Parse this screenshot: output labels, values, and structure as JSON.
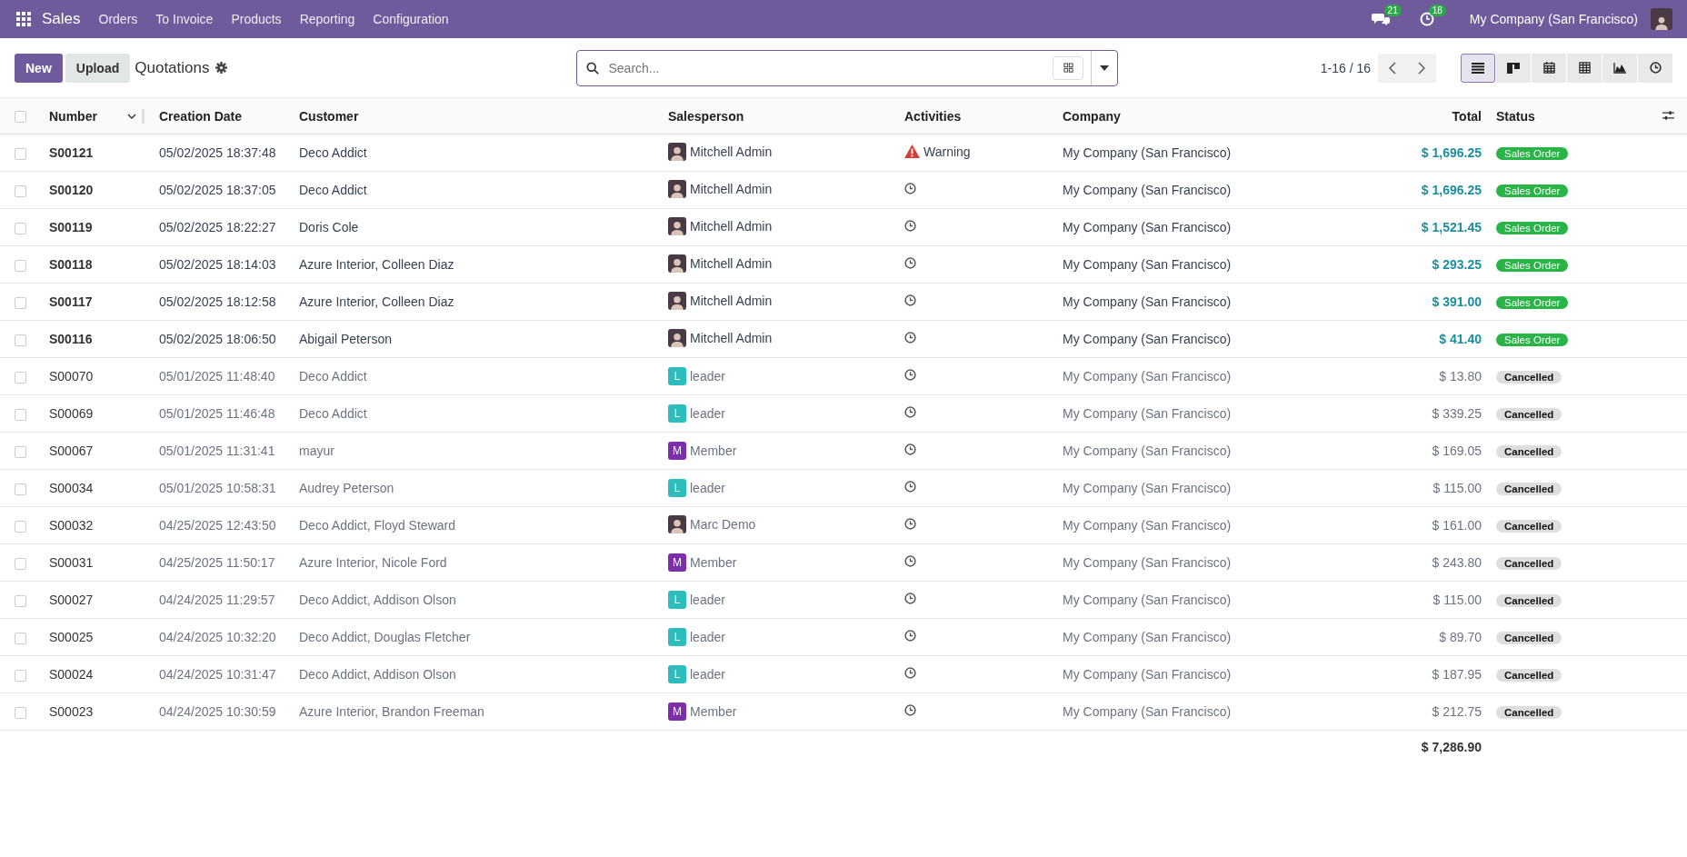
{
  "navbar": {
    "app": "Sales",
    "menu": [
      "Orders",
      "To Invoice",
      "Products",
      "Reporting",
      "Configuration"
    ],
    "messages_count": "21",
    "activities_count": "18",
    "company": "My Company (San Francisco)"
  },
  "control_panel": {
    "new_button": "New",
    "upload_button": "Upload",
    "breadcrumb": "Quotations",
    "search": {
      "placeholder": "Search..."
    },
    "pager": "1-16 / 16",
    "views": [
      {
        "kind": "list",
        "selected": true
      },
      {
        "kind": "kanban",
        "selected": false
      },
      {
        "kind": "calendar",
        "selected": false
      },
      {
        "kind": "pivot",
        "selected": false
      },
      {
        "kind": "graph",
        "selected": false
      },
      {
        "kind": "activity",
        "selected": false
      }
    ]
  },
  "table": {
    "select_all_checked": false,
    "columns": [
      "Number",
      "Creation Date",
      "Customer",
      "Salesperson",
      "Activities",
      "Company",
      "Total",
      "Status"
    ],
    "rows": [
      {
        "checked": false,
        "number": "S00121",
        "date": "05/02/2025 18:37:48",
        "customer": "Deco Addict",
        "salesperson": {
          "name": "Mitchell Admin",
          "kind": "photo"
        },
        "activity": {
          "kind": "warning",
          "label": "Warning"
        },
        "company": "My Company (San Francisco)",
        "total": "$ 1,696.25",
        "status": {
          "kind": "sale",
          "label": "Sales Order"
        }
      },
      {
        "checked": false,
        "number": "S00120",
        "date": "05/02/2025 18:37:05",
        "customer": "Deco Addict",
        "salesperson": {
          "name": "Mitchell Admin",
          "kind": "photo"
        },
        "activity": {
          "kind": "clock"
        },
        "company": "My Company (San Francisco)",
        "total": "$ 1,696.25",
        "status": {
          "kind": "sale",
          "label": "Sales Order"
        }
      },
      {
        "checked": false,
        "number": "S00119",
        "date": "05/02/2025 18:22:27",
        "customer": "Doris Cole",
        "salesperson": {
          "name": "Mitchell Admin",
          "kind": "photo"
        },
        "activity": {
          "kind": "clock"
        },
        "company": "My Company (San Francisco)",
        "total": "$ 1,521.45",
        "status": {
          "kind": "sale",
          "label": "Sales Order"
        }
      },
      {
        "checked": false,
        "number": "S00118",
        "date": "05/02/2025 18:14:03",
        "customer": "Azure Interior, Colleen Diaz",
        "salesperson": {
          "name": "Mitchell Admin",
          "kind": "photo"
        },
        "activity": {
          "kind": "clock"
        },
        "company": "My Company (San Francisco)",
        "total": "$ 293.25",
        "status": {
          "kind": "sale",
          "label": "Sales Order"
        }
      },
      {
        "checked": false,
        "number": "S00117",
        "date": "05/02/2025 18:12:58",
        "customer": "Azure Interior, Colleen Diaz",
        "salesperson": {
          "name": "Mitchell Admin",
          "kind": "photo"
        },
        "activity": {
          "kind": "clock"
        },
        "company": "My Company (San Francisco)",
        "total": "$ 391.00",
        "status": {
          "kind": "sale",
          "label": "Sales Order"
        }
      },
      {
        "checked": false,
        "number": "S00116",
        "date": "05/02/2025 18:06:50",
        "customer": "Abigail Peterson",
        "salesperson": {
          "name": "Mitchell Admin",
          "kind": "photo"
        },
        "activity": {
          "kind": "clock"
        },
        "company": "My Company (San Francisco)",
        "total": "$ 41.40",
        "status": {
          "kind": "sale",
          "label": "Sales Order"
        }
      },
      {
        "checked": false,
        "number": "S00070",
        "date": "05/01/2025 11:48:40",
        "customer": "Deco Addict",
        "salesperson": {
          "name": "leader",
          "kind": "letter",
          "initial": "L",
          "color": "#2ebdbd"
        },
        "activity": {
          "kind": "clock"
        },
        "company": "My Company (San Francisco)",
        "total": "$ 13.80",
        "status": {
          "kind": "cancel",
          "label": "Cancelled"
        }
      },
      {
        "checked": false,
        "number": "S00069",
        "date": "05/01/2025 11:46:48",
        "customer": "Deco Addict",
        "salesperson": {
          "name": "leader",
          "kind": "letter",
          "initial": "L",
          "color": "#2ebdbd"
        },
        "activity": {
          "kind": "clock"
        },
        "company": "My Company (San Francisco)",
        "total": "$ 339.25",
        "status": {
          "kind": "cancel",
          "label": "Cancelled"
        }
      },
      {
        "checked": false,
        "number": "S00067",
        "date": "05/01/2025 11:31:41",
        "customer": "mayur",
        "salesperson": {
          "name": "Member",
          "kind": "letter",
          "initial": "M",
          "color": "#7c2fa8"
        },
        "activity": {
          "kind": "clock"
        },
        "company": "My Company (San Francisco)",
        "total": "$ 169.05",
        "status": {
          "kind": "cancel",
          "label": "Cancelled"
        }
      },
      {
        "checked": false,
        "number": "S00034",
        "date": "05/01/2025 10:58:31",
        "customer": "Audrey Peterson",
        "salesperson": {
          "name": "leader",
          "kind": "letter",
          "initial": "L",
          "color": "#2ebdbd"
        },
        "activity": {
          "kind": "clock"
        },
        "company": "My Company (San Francisco)",
        "total": "$ 115.00",
        "status": {
          "kind": "cancel",
          "label": "Cancelled"
        }
      },
      {
        "checked": false,
        "number": "S00032",
        "date": "04/25/2025 12:43:50",
        "customer": "Deco Addict, Floyd Steward",
        "salesperson": {
          "name": "Marc Demo",
          "kind": "photo"
        },
        "activity": {
          "kind": "clock"
        },
        "company": "My Company (San Francisco)",
        "total": "$ 161.00",
        "status": {
          "kind": "cancel",
          "label": "Cancelled"
        }
      },
      {
        "checked": false,
        "number": "S00031",
        "date": "04/25/2025 11:50:17",
        "customer": "Azure Interior, Nicole Ford",
        "salesperson": {
          "name": "Member",
          "kind": "letter",
          "initial": "M",
          "color": "#7c2fa8"
        },
        "activity": {
          "kind": "clock"
        },
        "company": "My Company (San Francisco)",
        "total": "$ 243.80",
        "status": {
          "kind": "cancel",
          "label": "Cancelled"
        }
      },
      {
        "checked": false,
        "number": "S00027",
        "date": "04/24/2025 11:29:57",
        "customer": "Deco Addict, Addison Olson",
        "salesperson": {
          "name": "leader",
          "kind": "letter",
          "initial": "L",
          "color": "#2ebdbd"
        },
        "activity": {
          "kind": "clock"
        },
        "company": "My Company (San Francisco)",
        "total": "$ 115.00",
        "status": {
          "kind": "cancel",
          "label": "Cancelled"
        }
      },
      {
        "checked": false,
        "number": "S00025",
        "date": "04/24/2025 10:32:20",
        "customer": "Deco Addict, Douglas Fletcher",
        "salesperson": {
          "name": "leader",
          "kind": "letter",
          "initial": "L",
          "color": "#2ebdbd"
        },
        "activity": {
          "kind": "clock"
        },
        "company": "My Company (San Francisco)",
        "total": "$ 89.70",
        "status": {
          "kind": "cancel",
          "label": "Cancelled"
        }
      },
      {
        "checked": false,
        "number": "S00024",
        "date": "04/24/2025 10:31:47",
        "customer": "Deco Addict, Addison Olson",
        "salesperson": {
          "name": "leader",
          "kind": "letter",
          "initial": "L",
          "color": "#2ebdbd"
        },
        "activity": {
          "kind": "clock"
        },
        "company": "My Company (San Francisco)",
        "total": "$ 187.95",
        "status": {
          "kind": "cancel",
          "label": "Cancelled"
        }
      },
      {
        "checked": false,
        "number": "S00023",
        "date": "04/24/2025 10:30:59",
        "customer": "Azure Interior, Brandon Freeman",
        "salesperson": {
          "name": "Member",
          "kind": "letter",
          "initial": "M",
          "color": "#7c2fa8"
        },
        "activity": {
          "kind": "clock"
        },
        "company": "My Company (San Francisco)",
        "total": "$ 212.75",
        "status": {
          "kind": "cancel",
          "label": "Cancelled"
        }
      }
    ],
    "sum_total": "$ 7,286.90"
  }
}
